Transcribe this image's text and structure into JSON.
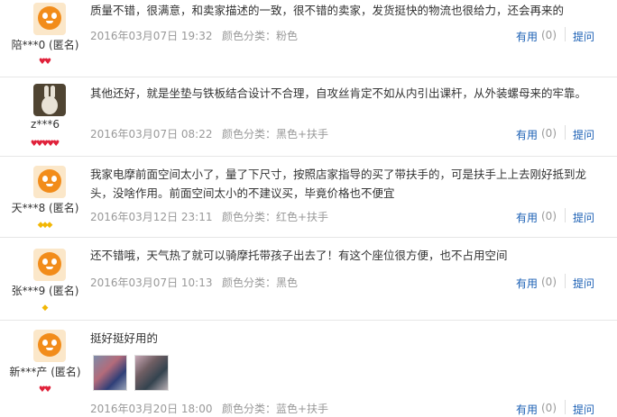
{
  "reviews": [
    {
      "username": "陪***0 (匿名)",
      "avatar": "default-orange-avatar",
      "badge_type": "red-heart",
      "badge_count": 2,
      "content": "质量不错，很满意，和卖家描述的一致，很不错的卖家，发货挺快的物流也很给力，还会再来的",
      "date": "2016年03月07日 19:32",
      "color_label": "颜色分类：粉色",
      "useful_label": "有用",
      "useful_count": "(0)",
      "ask_label": "提问"
    },
    {
      "username": "z***6",
      "avatar": "rabbit-photo-avatar",
      "badge_type": "red-heart",
      "badge_count": 5,
      "content": "其他还好，就是坐垫与铁板结合设计不合理，自攻丝肯定不如从内引出课杆，从外装螺母来的牢靠。",
      "date": "2016年03月07日 08:22",
      "color_label": "颜色分类：黑色+扶手",
      "useful_label": "有用",
      "useful_count": "(0)",
      "ask_label": "提问"
    },
    {
      "username": "天***8 (匿名)",
      "avatar": "default-orange-avatar",
      "badge_type": "gold-diamond",
      "badge_count": 3,
      "content": "我家电摩前面空间太小了，量了下尺寸，按照店家指导的买了带扶手的，可是扶手上上去刚好抵到龙头，没啥作用。前面空间太小的不建议买，毕竟价格也不便宜",
      "date": "2016年03月12日 23:11",
      "color_label": "颜色分类：红色+扶手",
      "useful_label": "有用",
      "useful_count": "(0)",
      "ask_label": "提问"
    },
    {
      "username": "张***9 (匿名)",
      "avatar": "default-orange-avatar",
      "badge_type": "gold-diamond",
      "badge_count": 1,
      "content": "还不错哦，天气热了就可以骑摩托带孩子出去了！有这个座位很方便，也不占用空间",
      "date": "2016年03月07日 10:13",
      "color_label": "颜色分类：黑色",
      "useful_label": "有用",
      "useful_count": "(0)",
      "ask_label": "提问"
    },
    {
      "username": "新***产 (匿名)",
      "avatar": "default-orange-avatar",
      "badge_type": "red-heart",
      "badge_count": 2,
      "content": "挺好挺好用的",
      "date": "2016年03月20日 18:00",
      "color_label": "颜色分类：蓝色+扶手",
      "useful_label": "有用",
      "useful_count": "(0)",
      "ask_label": "提问",
      "photos": 2
    }
  ],
  "colors": {
    "link": "#1a5fb4",
    "meta_text": "#999999",
    "badge_red": "#e0213a",
    "badge_gold": "#f2b705",
    "avatar_orange": "#f28c1a"
  }
}
